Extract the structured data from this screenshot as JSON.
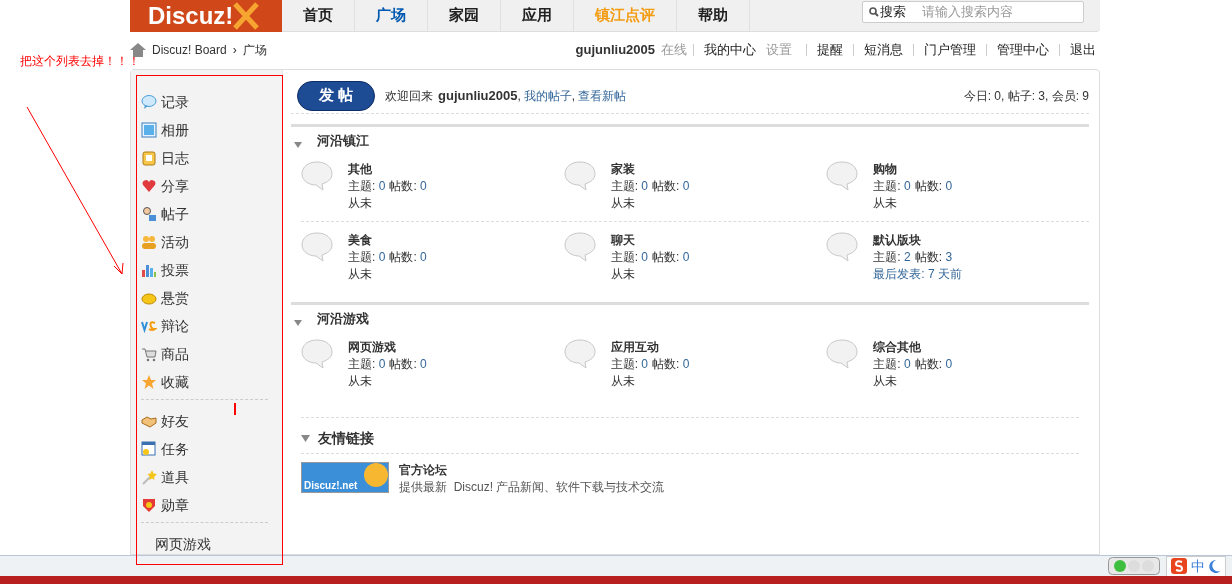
{
  "logo": "Discuz!",
  "nav": [
    {
      "label": "首页",
      "selected": false,
      "highlighted": false
    },
    {
      "label": "广场",
      "selected": true,
      "highlighted": false
    },
    {
      "label": "家园",
      "selected": false,
      "highlighted": false
    },
    {
      "label": "应用",
      "selected": false,
      "highlighted": false
    },
    {
      "label": "镇江点评",
      "selected": false,
      "highlighted": true
    },
    {
      "label": "帮助",
      "selected": false,
      "highlighted": false
    }
  ],
  "search": {
    "button": "搜索",
    "placeholder": "请输入搜索内容"
  },
  "annotation": "把这个列表去掉！！！",
  "breadcrumb": [
    "Discuz! Board",
    "›",
    "广场"
  ],
  "user_bar": {
    "username": "gujunliu2005",
    "status": "在线",
    "links": [
      {
        "label": "我的中心",
        "extra": "设置"
      },
      {
        "label": "提醒"
      },
      {
        "label": "短消息"
      },
      {
        "label": "门户管理"
      },
      {
        "label": "管理中心"
      },
      {
        "label": "退出"
      }
    ]
  },
  "sidebar": {
    "groups": [
      [
        {
          "label": "记录"
        },
        {
          "label": "相册"
        },
        {
          "label": "日志"
        },
        {
          "label": "分享"
        },
        {
          "label": "帖子"
        },
        {
          "label": "活动"
        },
        {
          "label": "投票"
        },
        {
          "label": "悬赏"
        },
        {
          "label": "辩论"
        },
        {
          "label": "商品"
        },
        {
          "label": "收藏"
        }
      ],
      [
        {
          "label": "好友"
        },
        {
          "label": "任务"
        },
        {
          "label": "道具"
        },
        {
          "label": "勋章"
        }
      ],
      [
        {
          "label": "网页游戏"
        }
      ]
    ]
  },
  "post_button": "发 帖",
  "welcome": {
    "text": "欢迎回来",
    "username": "gujunliu2005",
    "links": [
      {
        "sep": ",",
        "label": "我的帖子"
      },
      {
        "sep": ",",
        "label": "查看新帖"
      }
    ]
  },
  "stats": "今日: 0, 帖子: 3, 会员: 9",
  "categories": [
    {
      "title": "河沿镇江",
      "forums": [
        {
          "name": "其他",
          "topics_label": "主题:",
          "topics": "0",
          "posts_label": "帖数:",
          "posts": "0",
          "last": "从未",
          "kind": "never"
        },
        {
          "name": "家装",
          "topics_label": "主题:",
          "topics": "0",
          "posts_label": "帖数:",
          "posts": "0",
          "last": "从未",
          "kind": "never"
        },
        {
          "name": "购物",
          "topics_label": "主题:",
          "topics": "0",
          "posts_label": "帖数:",
          "posts": "0",
          "last": "从未",
          "kind": "never"
        },
        {
          "name": "美食",
          "topics_label": "主题:",
          "topics": "0",
          "posts_label": "帖数:",
          "posts": "0",
          "last": "从未",
          "kind": "never"
        },
        {
          "name": "聊天",
          "topics_label": "主题:",
          "topics": "0",
          "posts_label": "帖数:",
          "posts": "0",
          "last": "从未",
          "kind": "never"
        },
        {
          "name": "默认版块",
          "topics_label": "主题:",
          "topics": "2",
          "posts_label": "帖数:",
          "posts": "3",
          "last": "最后发表: 7 天前",
          "kind": "link"
        }
      ]
    },
    {
      "title": "河沿游戏",
      "forums": [
        {
          "name": "网页游戏",
          "topics_label": "主题:",
          "topics": "0",
          "posts_label": "帖数:",
          "posts": "0",
          "last": "从未",
          "kind": "never"
        },
        {
          "name": "应用互动",
          "topics_label": "主题:",
          "topics": "0",
          "posts_label": "帖数:",
          "posts": "0",
          "last": "从未",
          "kind": "never"
        },
        {
          "name": "综合其他",
          "topics_label": "主题:",
          "topics": "0",
          "posts_label": "帖数:",
          "posts": "0",
          "last": "从未",
          "kind": "never"
        }
      ]
    }
  ],
  "friend_links": {
    "title": "友情链接",
    "items": [
      {
        "name": "官方论坛",
        "logo_text": "Discuz!.net",
        "desc": "提供最新  Discuz! 产品新闻、软件下载与技术交流"
      }
    ]
  },
  "tray": {
    "ime": "中"
  }
}
